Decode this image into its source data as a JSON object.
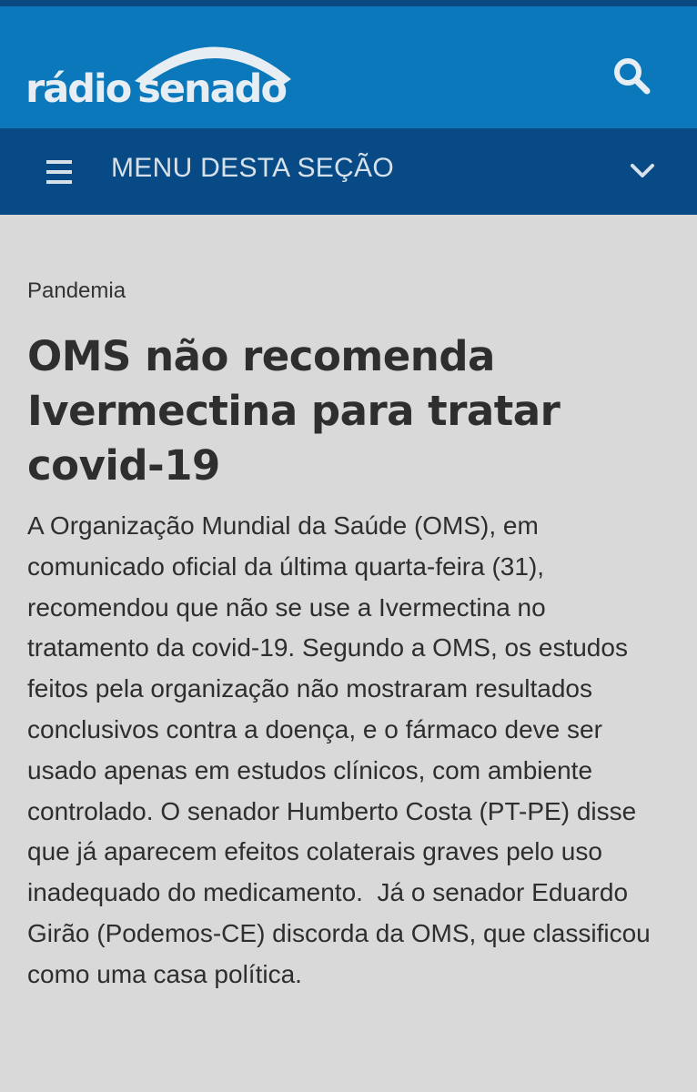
{
  "header": {
    "logo_text_part1": "rádio",
    "logo_text_part2": "senado",
    "logo_icon": "signal-arc-icon",
    "search_icon": "search-icon",
    "bg_color": "#0a78ba",
    "strip_color": "#0b4a80"
  },
  "nav": {
    "menu_icon": "hamburger-menu-icon",
    "menu_label": "MENU DESTA SEÇÃO",
    "expand_icon": "chevron-down-icon",
    "bg_color": "#074a86"
  },
  "article": {
    "category": "Pandemia",
    "title": "OMS não recomenda Ivermectina para tratar covid-19",
    "body": "A Organização Mundial da Saúde (OMS), em comunicado oficial da última quarta-feira (31), recomendou que não se use a Ivermectina no tratamento da covid-19. Segundo a OMS, os estudos feitos pela organização não mostraram resultados conclusivos contra a doença, e o fármaco deve ser usado apenas em estudos clínicos, com ambiente controlado. O senador Humberto Costa (PT-PE) disse que já aparecem efeitos colaterais graves pelo uso inadequado do medicamento.  Já o senador Eduardo Girão (Podemos-CE) discorda da OMS, que classificou como uma casa política."
  },
  "colors": {
    "page_background": "#d9d9d9",
    "text": "#2e2e2e",
    "logo_text": "#e6eef4"
  }
}
